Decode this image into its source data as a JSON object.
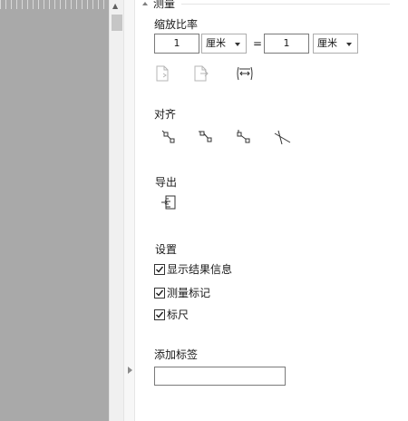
{
  "panel": {
    "section_title": "测量",
    "scale": {
      "label": "缩放比率",
      "left_value": "1",
      "left_unit": "厘米",
      "equals": "=",
      "right_value": "1",
      "right_unit": "厘米"
    },
    "align": {
      "label": "对齐"
    },
    "export": {
      "label": "导出"
    },
    "settings": {
      "label": "设置",
      "items": [
        {
          "label": "显示结果信息",
          "checked": true
        },
        {
          "label": "测量标记",
          "checked": true
        },
        {
          "label": "标尺",
          "checked": true
        }
      ]
    },
    "add_tag": {
      "label": "添加标签",
      "value": ""
    }
  },
  "icons": {
    "scale_row": [
      "page-copy-icon",
      "page-paste-icon",
      "fit-width-icon"
    ],
    "align_row": [
      "align-diagonal-down-icon",
      "align-horizontal-step-icon",
      "align-vertical-step-icon",
      "align-intersect-icon"
    ],
    "export_row": [
      "export-ruler-icon"
    ]
  }
}
